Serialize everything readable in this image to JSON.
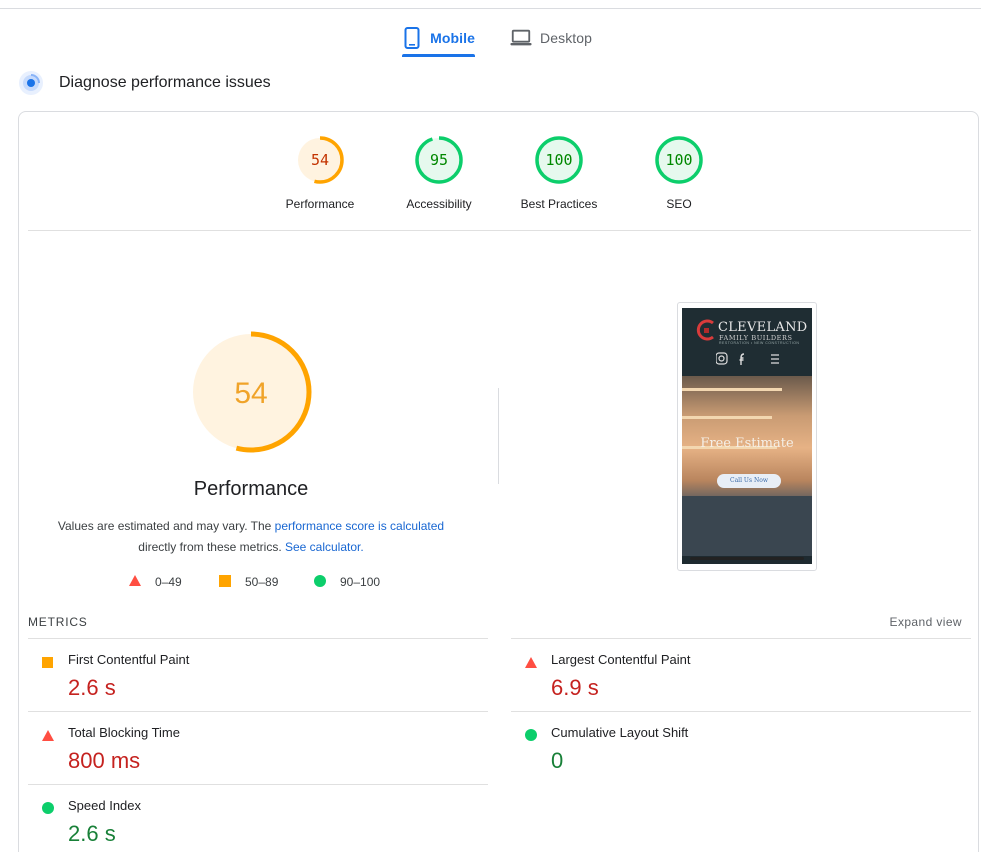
{
  "tabs": [
    {
      "label": "Mobile",
      "active": true,
      "icon": "smartphone-icon"
    },
    {
      "label": "Desktop",
      "active": false,
      "icon": "laptop-icon"
    }
  ],
  "diagnose": {
    "title": "Diagnose performance issues",
    "icon": "lighthouse-icon"
  },
  "gauges": [
    {
      "score": "54",
      "label": "Performance",
      "status": "average",
      "color": "#ffa400",
      "value": 54
    },
    {
      "score": "95",
      "label": "Accessibility",
      "status": "pass",
      "color": "#0cce6b",
      "value": 95
    },
    {
      "score": "100",
      "label": "Best Practices",
      "status": "pass",
      "color": "#0cce6b",
      "value": 100
    },
    {
      "score": "100",
      "label": "SEO",
      "status": "pass",
      "color": "#0cce6b",
      "value": 100
    }
  ],
  "main_gauge": {
    "score": "54",
    "title": "Performance",
    "value": 54,
    "color": "#ffa400"
  },
  "note": {
    "text1": "Values are estimated and may vary. The ",
    "link1": "performance score is calculated",
    "text2": "directly from these metrics. ",
    "link2": "See calculator."
  },
  "legend": [
    {
      "range": "0–49",
      "shape": "triangle",
      "color": "#ff4e42"
    },
    {
      "range": "50–89",
      "shape": "square",
      "color": "#ffa400"
    },
    {
      "range": "90–100",
      "shape": "circle",
      "color": "#0cce6b"
    }
  ],
  "screenshot": {
    "brand": "CLEVELAND",
    "brand_sub": "FAMILY BUILDERS",
    "brand_tagline": "RESTORATION • NEW CONSTRUCTION",
    "hero_title": "Free Estimate",
    "cta": "Call Us Now"
  },
  "metrics": {
    "title": "METRICS",
    "expand_label": "Expand view",
    "items": [
      {
        "name": "First Contentful Paint",
        "value": "2.6 s",
        "status": "average"
      },
      {
        "name": "Largest Contentful Paint",
        "value": "6.9 s",
        "status": "fail"
      },
      {
        "name": "Total Blocking Time",
        "value": "800 ms",
        "status": "fail"
      },
      {
        "name": "Cumulative Layout Shift",
        "value": "0",
        "status": "pass"
      },
      {
        "name": "Speed Index",
        "value": "2.6 s",
        "status": "pass"
      }
    ]
  },
  "colors": {
    "accent": "#1a73e8",
    "pass": "#0cce6b",
    "average": "#ffa400",
    "fail": "#ff4e42"
  }
}
